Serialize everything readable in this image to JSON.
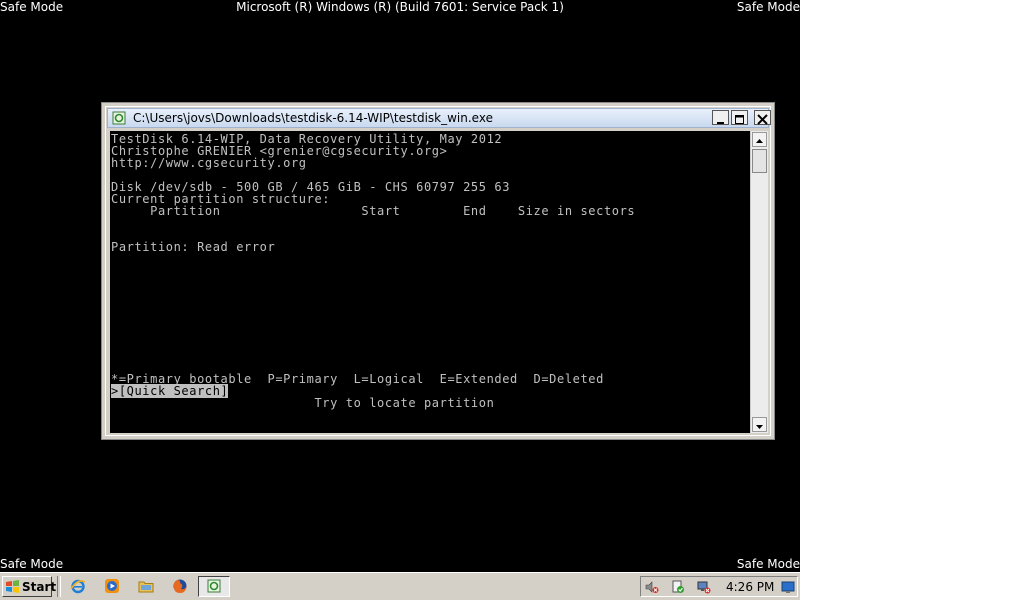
{
  "desktop": {
    "safe_mode_label": "Safe Mode",
    "build_title": "Microsoft (R) Windows (R) (Build 7601: Service Pack 1)"
  },
  "console_window": {
    "title": "C:\\Users\\jovs\\Downloads\\testdisk-6.14-WIP\\testdisk_win.exe",
    "lines": [
      "TestDisk 6.14-WIP, Data Recovery Utility, May 2012",
      "Christophe GRENIER <grenier@cgsecurity.org>",
      "http://www.cgsecurity.org",
      "",
      "Disk /dev/sdb - 500 GB / 465 GiB - CHS 60797 255 63",
      "Current partition structure:",
      "     Partition                  Start        End    Size in sectors",
      "",
      "",
      "Partition: Read error"
    ],
    "legend": "*=Primary bootable  P=Primary  L=Logical  E=Extended  D=Deleted",
    "menu_selected": ">[Quick Search]",
    "hint": "                          Try to locate partition"
  },
  "taskbar": {
    "start_label": "Start",
    "quick_launch": [
      "ie-icon",
      "media-player-icon",
      "folder-icon",
      "firefox-icon"
    ],
    "task_button_icon": "testdisk-icon",
    "tray_icons": [
      "volume-muted-icon",
      "action-center-icon",
      "network-disconnected-icon",
      "show-desktop-icon"
    ],
    "clock": "4:26 PM"
  },
  "colors": {
    "console_bg": "#000000",
    "console_fg": "#c0c0c0",
    "desktop_bg": "#000000",
    "taskbar_bg": "#d4d0c8"
  }
}
